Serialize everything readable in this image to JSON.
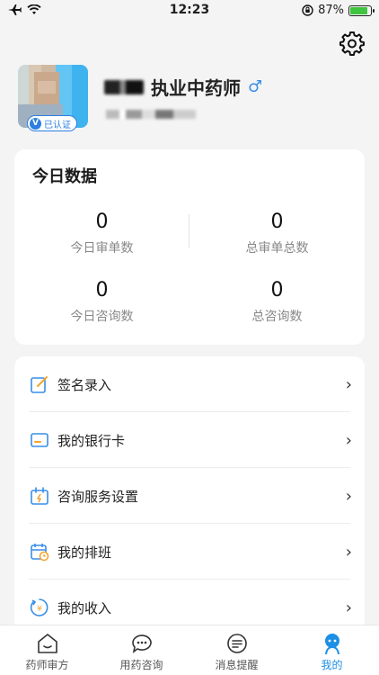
{
  "status_bar": {
    "time": "12:23",
    "battery": "87%",
    "battery_level": 0.87
  },
  "profile": {
    "title": "执业中药师",
    "gender_symbol": "♂",
    "verified_label": "已认证",
    "verified_mark": "V"
  },
  "today_data": {
    "title": "今日数据",
    "stats": [
      {
        "value": "0",
        "label": "今日审单数"
      },
      {
        "value": "0",
        "label": "总审单总数"
      },
      {
        "value": "0",
        "label": "今日咨询数"
      },
      {
        "value": "0",
        "label": "总咨询数"
      }
    ]
  },
  "menu": {
    "items": [
      {
        "label": "签名录入",
        "icon": "signature-icon"
      },
      {
        "label": "我的银行卡",
        "icon": "bank-card-icon"
      },
      {
        "label": "咨询服务设置",
        "icon": "consult-settings-icon"
      },
      {
        "label": "我的排班",
        "icon": "schedule-icon"
      },
      {
        "label": "我的收入",
        "icon": "income-icon"
      }
    ],
    "arrow": "›"
  },
  "tabs": [
    {
      "label": "药师审方",
      "icon": "home-icon"
    },
    {
      "label": "用药咨询",
      "icon": "chat-icon"
    },
    {
      "label": "消息提醒",
      "icon": "message-icon"
    },
    {
      "label": "我的",
      "icon": "profile-icon"
    }
  ],
  "colors": {
    "accent": "#1d8fe6",
    "verified": "#2b7fe0",
    "icon_orange": "#f3a531",
    "icon_blue": "#3a8ee6"
  }
}
